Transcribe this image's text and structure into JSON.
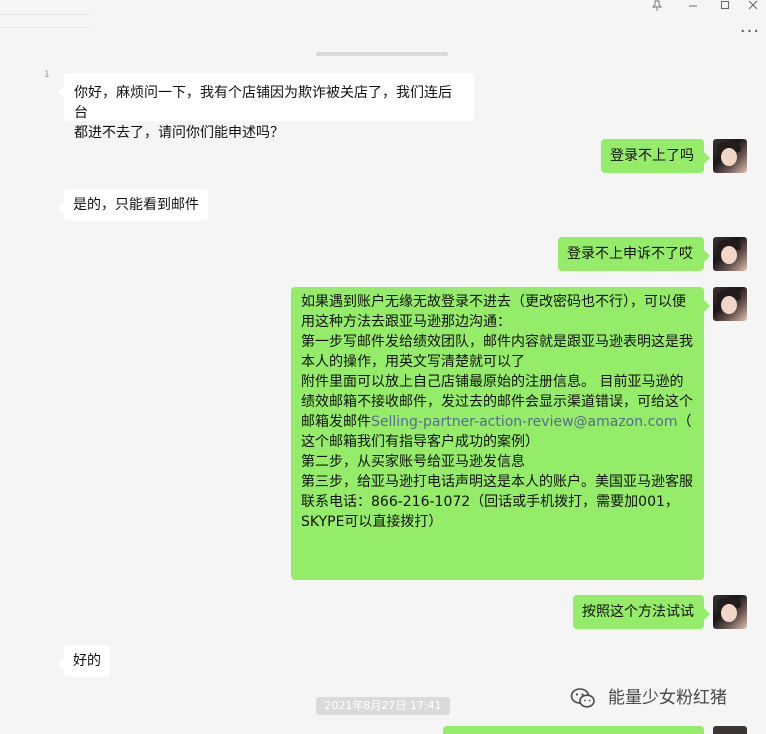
{
  "window": {
    "pin_icon": "pin-icon",
    "minimize_icon": "minimize-icon",
    "maximize_icon": "maximize-icon",
    "close_icon": "close-icon",
    "more_icon": "more-icon",
    "more_glyph": "···"
  },
  "chat": {
    "unread_marker": "1",
    "messages": [
      {
        "side": "incoming",
        "text": "你好，麻烦问一下，我有个店铺因为欺诈被关店了，我们连后台\n都进不去了，请问你们能申述吗？"
      },
      {
        "side": "outgoing",
        "text": "登录不上了吗"
      },
      {
        "side": "incoming",
        "text": "是的，只能看到邮件"
      },
      {
        "side": "outgoing",
        "text": "登录不上申诉不了哎"
      },
      {
        "side": "outgoing",
        "text_before_link": "如果遇到账户无缘无故登录不进去（更改密码也不行），可以便\n用这种方法去跟亚马逊那边沟通：\n第一步写邮件发给绩效团队，邮件内容就是跟亚马逊表明这是我\n本人的操作，用英文写清楚就可以了\n附件里面可以放上自己店铺最原始的注册信息。 目前亚马逊的\n绩效邮箱不接收邮件，发过去的邮件会显示渠道错误，可给这个\n邮箱发邮件",
        "link": "Selling-partner-action-review@amazon.com",
        "text_after_link": "（\n这个邮箱我们有指导客户成功的案例）\n第二步，从买家账号给亚马逊发信息\n第三步，给亚马逊打电话声明这是本人的账户。美国亚马逊客服\n联系电话：866-216-1072（回话或手机拨打，需要加001，\nSKYPE可以直接拨打）"
      },
      {
        "side": "outgoing",
        "text": "按照这个方法试试"
      },
      {
        "side": "incoming",
        "text": "好的"
      }
    ],
    "timestamp": "2021年8月27日 17:41"
  },
  "watermark": {
    "icon": "wechat-official-account-icon",
    "text": "能量少女粉红猪"
  },
  "colors": {
    "background": "#f5f5f5",
    "outgoing_bubble": "#95ec69",
    "incoming_bubble": "#ffffff",
    "link": "#576b95"
  }
}
